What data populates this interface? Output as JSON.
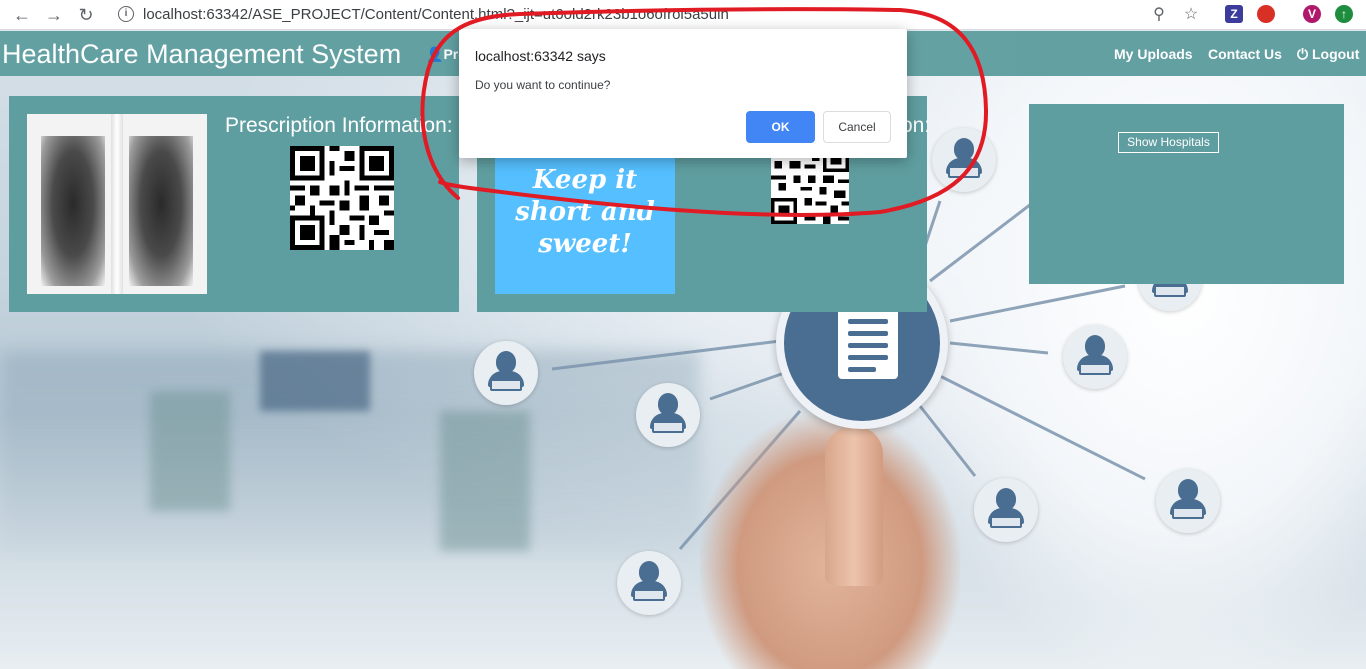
{
  "browser": {
    "back_icon": "arrow-left-icon",
    "forward_icon": "arrow-right-icon",
    "reload_icon": "reload-icon",
    "url": "localhost:63342/ASE_PROJECT/Content/Content.html?_ijt=ut6old2rk23b1o6ofrol5a5uih",
    "profile_initial": "V",
    "zoom_icon": "zoom-icon",
    "star_icon": "bookmark-star-icon",
    "ext_z": "Z"
  },
  "header": {
    "brand": "HealthCare Management System",
    "profile_label": "Pro",
    "my_uploads": "My Uploads",
    "contact_us": "Contact Us",
    "logout": "Logout",
    "color": "#5f9ea0"
  },
  "panels": {
    "left_title": "Prescription Information:",
    "mid_title_suffix": "on:",
    "poster_text": "Keep it short and sweet!",
    "show_hospitals": "Show Hospitals"
  },
  "dialog": {
    "title": "localhost:63342 says",
    "message": "Do you want to continue?",
    "ok": "OK",
    "cancel": "Cancel",
    "accent": "#4285f4"
  }
}
